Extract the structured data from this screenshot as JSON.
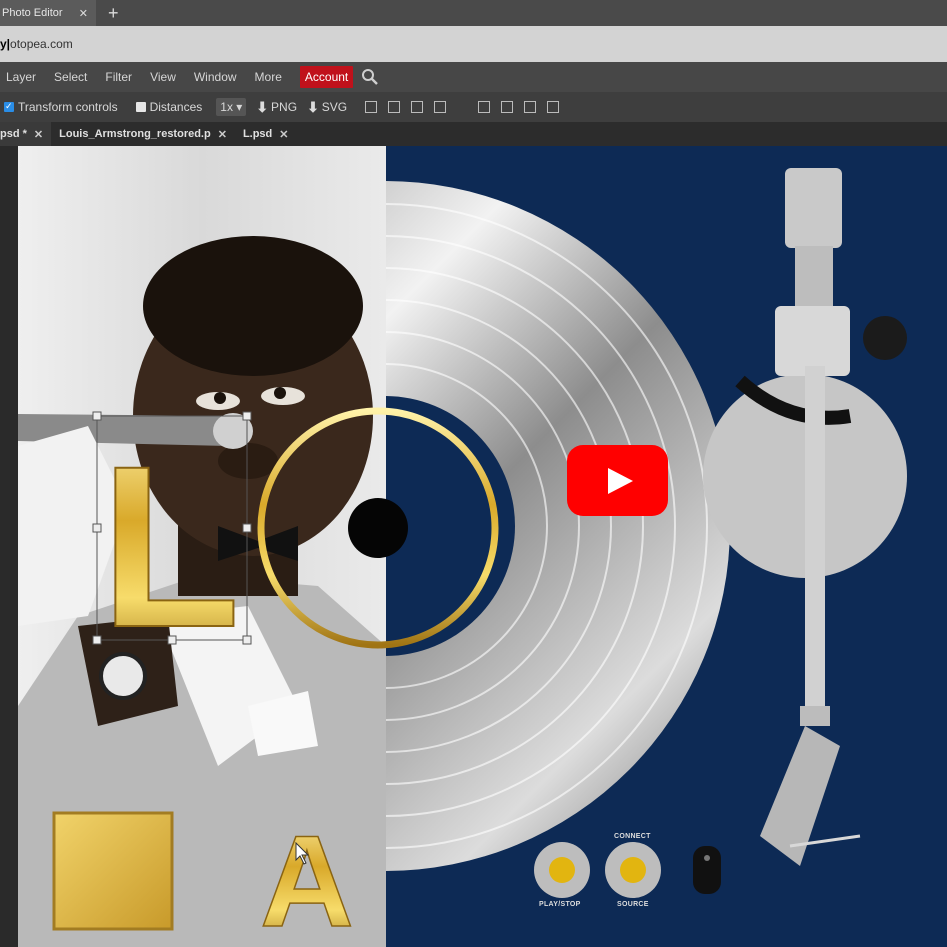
{
  "browser": {
    "tab_title": "Photo Editor",
    "tab_close": "✕",
    "new_tab": "+",
    "url": "otopea.com"
  },
  "menu": {
    "items": [
      "Layer",
      "Select",
      "Filter",
      "View",
      "Window",
      "More"
    ],
    "account": "Account"
  },
  "options": {
    "transform_controls": "Transform controls",
    "distances": "Distances",
    "zoom": "1x ▾",
    "png": "PNG",
    "svg": "SVG"
  },
  "doc_tabs": [
    {
      "label": "psd *",
      "close": "✕"
    },
    {
      "label": "Louis_Armstrong_restored.p",
      "close": "✕"
    },
    {
      "label": "L.psd",
      "close": "✕"
    }
  ],
  "canvas": {
    "letter_l": "L",
    "letter_a": "A",
    "turntable_labels": {
      "connect": "CONNECT",
      "play_stop": "PLAY/STOP",
      "source": "SOURCE"
    }
  },
  "colors": {
    "account": "#c0111b",
    "navy": "#0d2a55",
    "gold": "#d9b433",
    "youtube_red": "#ff0000"
  }
}
